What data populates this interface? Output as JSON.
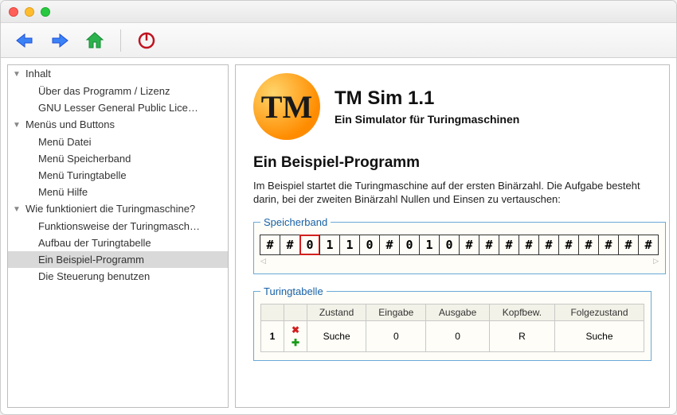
{
  "app": {
    "title": "TM Sim 1.1",
    "subtitle": "Ein Simulator für Turingmaschinen",
    "logo_text": "TM"
  },
  "sidebar": {
    "items": [
      {
        "label": "Inhalt",
        "level": 0,
        "expanded": true
      },
      {
        "label": "Über das Programm / Lizenz",
        "level": 1
      },
      {
        "label": "GNU Lesser General Public Lice…",
        "level": 1
      },
      {
        "label": "Menüs und Buttons",
        "level": 0,
        "expanded": true
      },
      {
        "label": "Menü Datei",
        "level": 1
      },
      {
        "label": "Menü Speicherband",
        "level": 1
      },
      {
        "label": "Menü Turingtabelle",
        "level": 1
      },
      {
        "label": "Menü Hilfe",
        "level": 1
      },
      {
        "label": "Wie funktioniert die Turingmaschine?",
        "level": 0,
        "expanded": true
      },
      {
        "label": "Funktionsweise der Turingmasch…",
        "level": 1
      },
      {
        "label": "Aufbau der Turingtabelle",
        "level": 1
      },
      {
        "label": "Ein Beispiel-Programm",
        "level": 1,
        "selected": true
      },
      {
        "label": "Die Steuerung benutzen",
        "level": 1
      }
    ]
  },
  "page": {
    "heading": "Ein Beispiel-Programm",
    "description": "Im Beispiel startet die Turingmaschine auf der ersten Binärzahl. Die Aufgabe besteht darin, bei der zweiten Binärzahl Nullen und Einsen zu vertauschen:"
  },
  "tape": {
    "legend": "Speicherband",
    "cells": [
      "#",
      "#",
      "0",
      "1",
      "1",
      "0",
      "#",
      "0",
      "1",
      "0",
      "#",
      "#",
      "#",
      "#",
      "#",
      "#",
      "#",
      "#",
      "#",
      "#"
    ],
    "head_index": 2,
    "scroll_left": "◁",
    "scroll_right": "▷"
  },
  "table": {
    "legend": "Turingtabelle",
    "columns": [
      "Zustand",
      "Eingabe",
      "Ausgabe",
      "Kopfbew.",
      "Folgezustand"
    ],
    "rows": [
      {
        "n": "1",
        "state": "Suche",
        "in": "0",
        "out": "0",
        "move": "R",
        "next": "Suche"
      }
    ]
  }
}
